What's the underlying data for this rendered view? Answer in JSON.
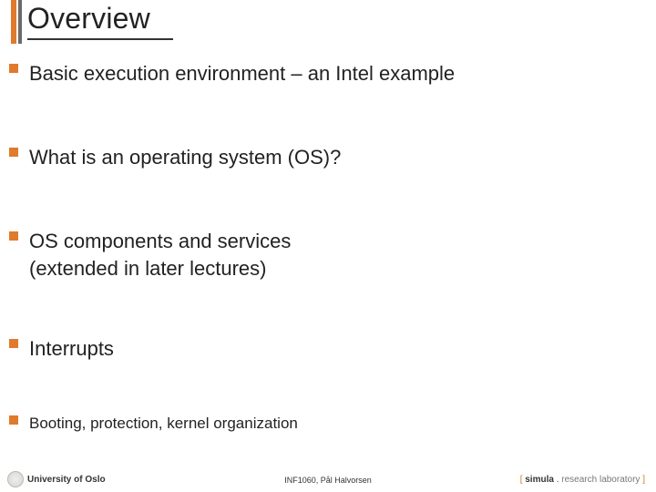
{
  "title": "Overview",
  "bullets": {
    "b1": "Basic execution environment – an Intel example",
    "b2": "What is an operating system (OS)?",
    "b3a": "OS components and services",
    "b3b": "(extended in later lectures)",
    "b4": "Interrupts",
    "b5": "Booting, protection, kernel organization"
  },
  "footer": {
    "left": "University of Oslo",
    "center": "INF1060, Pål Halvorsen",
    "right_open": "[ ",
    "right_bold": "simula",
    "right_dot": " . ",
    "right_tail": "research laboratory",
    "right_close": " ]"
  }
}
